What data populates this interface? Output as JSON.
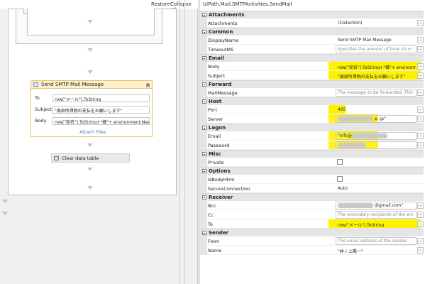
{
  "designer": {
    "toolbar": {
      "restore": "Restore",
      "collapse_all": "Collapse All"
    },
    "activity": {
      "title": "Send SMTP Mail Message",
      "to_label": "To",
      "to_value": "row(\"メール\").ToString",
      "subject_label": "Subject",
      "subject_value": "\"源泉所得税の支払をお願いします\"",
      "body_label": "Body",
      "body_value": "row(\"宛名\").ToString+\"様\"+ environment.New",
      "attach_files": "Attach Files"
    },
    "clear_activity": "Clear data table"
  },
  "properties": {
    "title": "UiPath.Mail.SMTPActivities.SendMail",
    "categories": [
      {
        "name": "Attachments",
        "rows": [
          {
            "name": "Attachments",
            "value": "(Collection)",
            "kind": "plain"
          }
        ]
      },
      {
        "name": "Common",
        "rows": [
          {
            "name": "DisplayName",
            "value": "Send SMTP Mail Message",
            "kind": "plain"
          },
          {
            "name": "TimeoutMS",
            "value": "Specifies the amount of time (in m",
            "kind": "placeholder"
          }
        ]
      },
      {
        "name": "Email",
        "rows": [
          {
            "name": "Body",
            "value": "row(\"宛名\").ToString+\"様\"+ environme",
            "kind": "highlight"
          },
          {
            "name": "Subject",
            "value": "\"源泉所得税の支払をお願いします\"",
            "kind": "highlight"
          }
        ]
      },
      {
        "name": "Forward",
        "rows": [
          {
            "name": "MailMessage",
            "value": "The message to be forwarded. This",
            "kind": "placeholder"
          }
        ]
      },
      {
        "name": "Host",
        "rows": [
          {
            "name": "Port",
            "value": "465",
            "kind": "highlight"
          },
          {
            "name": "Server",
            "value": "p .jp\"",
            "kind": "redacted"
          }
        ]
      },
      {
        "name": "Logon",
        "rows": [
          {
            "name": "Email",
            "value": "\"info@",
            "kind": "redacted"
          },
          {
            "name": "Password",
            "value": "",
            "kind": "redacted"
          }
        ]
      },
      {
        "name": "Misc",
        "rows": [
          {
            "name": "Private",
            "value": "",
            "kind": "checkbox"
          }
        ]
      },
      {
        "name": "Options",
        "rows": [
          {
            "name": "IsBodyHtml",
            "value": "",
            "kind": "checkbox"
          },
          {
            "name": "SecureConnection",
            "value": "Auto",
            "kind": "plain"
          }
        ]
      },
      {
        "name": "Receiver",
        "rows": [
          {
            "name": "Bcc",
            "value": "@gmail.com\"",
            "kind": "redacted"
          },
          {
            "name": "Cc",
            "value": "The secondary recipients of the em",
            "kind": "placeholder"
          },
          {
            "name": "To",
            "value": "row(\"メール\").ToString",
            "kind": "highlight"
          }
        ]
      },
      {
        "name": "Sender",
        "rows": [
          {
            "name": "From",
            "value": "The email address of the sender.",
            "kind": "placeholder"
          },
          {
            "name": "Name",
            "value": "\"井ノ上陽一\"",
            "kind": "plain"
          }
        ]
      }
    ],
    "colors": {
      "highlight": "#fff200",
      "activity_border": "#e8c460",
      "link": "#4a7ab8"
    }
  }
}
